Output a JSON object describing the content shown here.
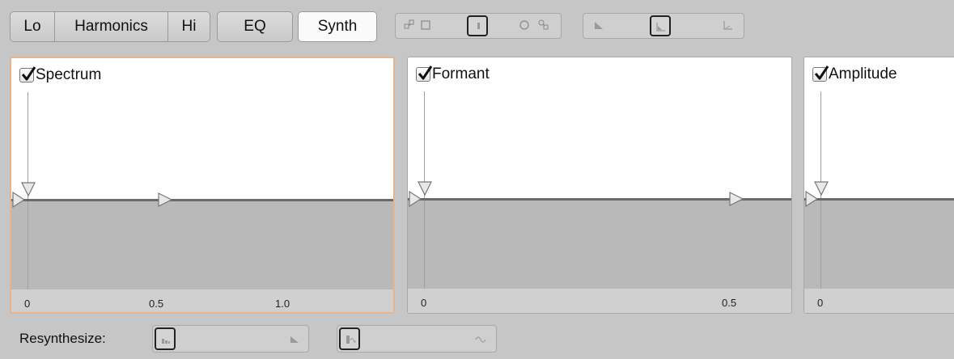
{
  "tabs": {
    "lo": "Lo",
    "harmonics": "Harmonics",
    "hi": "Hi",
    "eq": "EQ",
    "synth": "Synth",
    "active": "Synth"
  },
  "icons": {
    "link_left": "link-nodes-icon",
    "square": "square-icon",
    "bar_selected": "bar-icon",
    "circle": "circle-icon",
    "link_right": "link-nodes-icon",
    "ramp_left": "ramp-icon",
    "ramp_selected": "ramp-icon",
    "ramp_right": "ramp-icon"
  },
  "panels": [
    {
      "label": "Spectrum",
      "checked": true,
      "active": true,
      "ticks": [
        "0",
        "0.5",
        "1.0"
      ]
    },
    {
      "label": "Formant",
      "checked": true,
      "active": false,
      "ticks": [
        "0",
        "0.5"
      ]
    },
    {
      "label": "Amplitude",
      "checked": true,
      "active": false,
      "ticks": [
        "0"
      ]
    }
  ],
  "bottom": {
    "resynthesize_label": "Resynthesize:"
  },
  "colors": {
    "active_panel_border": "#e6b58d",
    "background": "#c6c6c6",
    "plot_area": "#ffffff",
    "below_baseline": "#b9b9b9"
  }
}
